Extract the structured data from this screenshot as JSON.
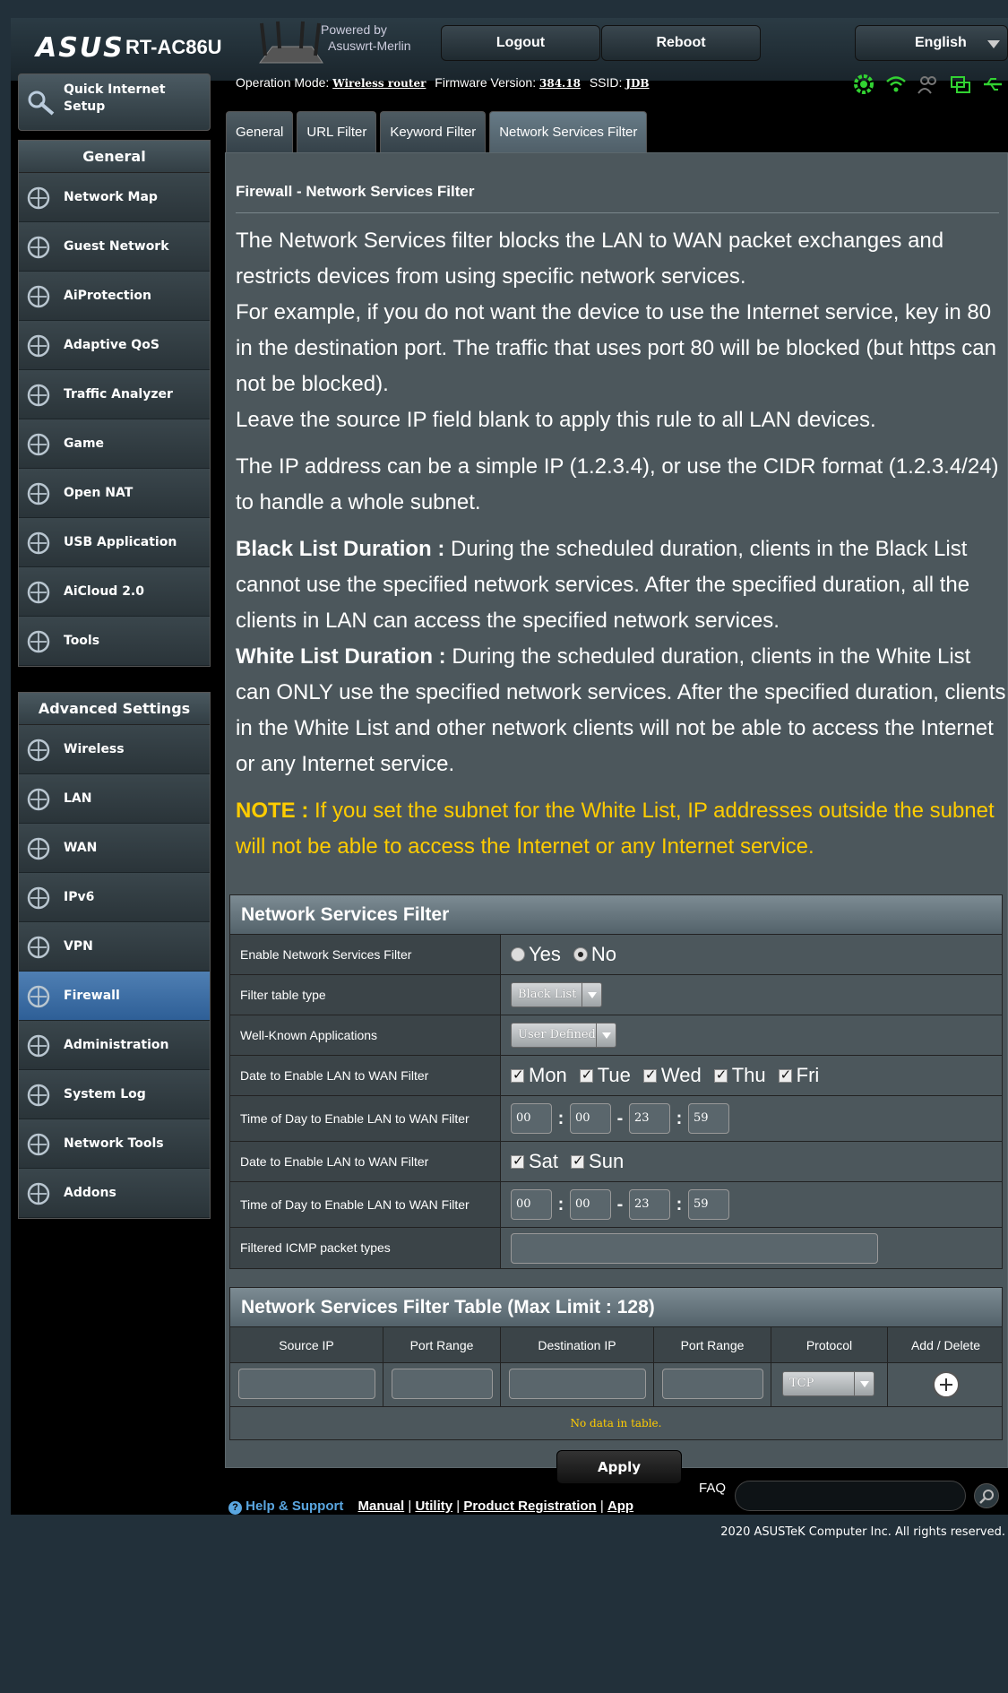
{
  "header": {
    "logo": "ASUS",
    "model": "RT-AC86U",
    "powered_line1": "Powered by",
    "powered_line2": "Asuswrt-Merlin",
    "logout": "Logout",
    "reboot": "Reboot",
    "language": "English"
  },
  "sidebar": {
    "qis_label": "Quick Internet Setup",
    "general_title": "General",
    "general_items": [
      "Network Map",
      "Guest Network",
      "AiProtection",
      "Adaptive QoS",
      "Traffic Analyzer",
      "Game",
      "Open NAT",
      "USB Application",
      "AiCloud 2.0",
      "Tools"
    ],
    "advanced_title": "Advanced Settings",
    "advanced_items": [
      "Wireless",
      "LAN",
      "WAN",
      "IPv6",
      "VPN",
      "Firewall",
      "Administration",
      "System Log",
      "Network Tools",
      "Addons"
    ],
    "active_item": "Firewall"
  },
  "info": {
    "op_mode_label": "Operation Mode:",
    "op_mode": "Wireless router",
    "fw_label": "Firmware Version:",
    "fw": "384.18",
    "ssid_label": "SSID:",
    "ssid": "JDB"
  },
  "tabs": [
    "General",
    "URL Filter",
    "Keyword Filter",
    "Network Services Filter"
  ],
  "active_tab": "Network Services Filter",
  "page": {
    "title": "Firewall - Network Services Filter",
    "p1a": "The Network Services filter blocks the LAN to WAN packet exchanges and restricts devices from using specific network services.",
    "p1b": "For example, if you do not want the device to use the Internet service, key in 80 in the destination port. The traffic that uses port 80 will be blocked (but https can not be blocked).",
    "p1c": "Leave the source IP field blank to apply this rule to all LAN devices.",
    "p2": "The IP address can be a simple IP (1.2.3.4), or use the CIDR format (1.2.3.4/24) to handle a whole subnet.",
    "black_label": "Black List Duration :",
    "black_text": " During the scheduled duration, clients in the Black List cannot use the specified network services. After the specified duration, all the clients in LAN can access the specified network services.",
    "white_label": "White List Duration :",
    "white_text": " During the scheduled duration, clients in the White List can ONLY use the specified network services. After the specified duration, clients in the White List and other network clients will not be able to access the Internet or any Internet service.",
    "note_label": "NOTE :",
    "note_text": " If you set the subnet for the White List, IP addresses outside the subnet will not be able to access the Internet or any Internet service."
  },
  "settings": {
    "title": "Network Services Filter",
    "enable_label": "Enable Network Services Filter",
    "yes": "Yes",
    "no": "No",
    "enabled": false,
    "filter_type_label": "Filter table type",
    "filter_type": "Black List",
    "apps_label": "Well-Known Applications",
    "apps": "User Defined",
    "date1_label": "Date to Enable LAN to WAN Filter",
    "weekdays": [
      "Mon",
      "Tue",
      "Wed",
      "Thu",
      "Fri"
    ],
    "time1_label": "Time of Day to Enable LAN to WAN Filter",
    "time1": [
      "00",
      "00",
      "23",
      "59"
    ],
    "date2_label": "Date to Enable LAN to WAN Filter",
    "weekend": [
      "Sat",
      "Sun"
    ],
    "time2_label": "Time of Day to Enable LAN to WAN Filter",
    "time2": [
      "00",
      "00",
      "23",
      "59"
    ],
    "icmp_label": "Filtered ICMP packet types"
  },
  "filter_table": {
    "title": "Network Services Filter Table (Max Limit : 128)",
    "columns": [
      "Source IP",
      "Port Range",
      "Destination IP",
      "Port Range",
      "Protocol",
      "Add / Delete"
    ],
    "protocol": "TCP",
    "empty": "No data in table."
  },
  "apply": "Apply",
  "footer": {
    "help": "Help & Support",
    "links": [
      "Manual",
      "Utility",
      "Product Registration",
      "App"
    ],
    "faq": "FAQ",
    "copyright": "2020 ASUSTeK Computer Inc. All rights reserved."
  },
  "colors": {
    "accent": "#2e5f97",
    "note": "#ffcc00",
    "status_green": "#32d232"
  }
}
